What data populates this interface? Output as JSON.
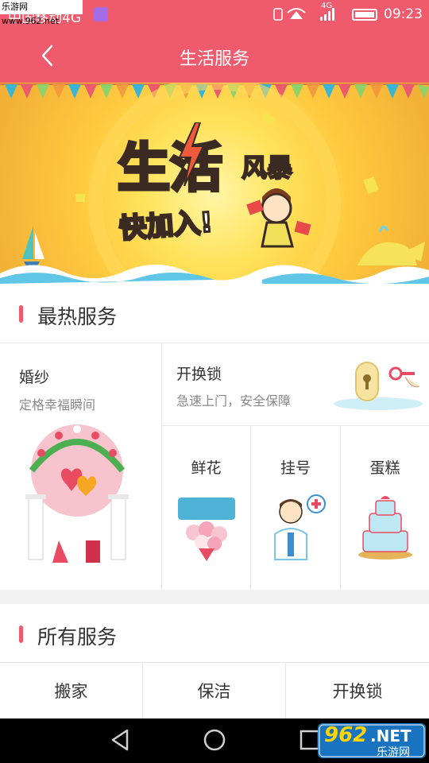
{
  "status_bar": {
    "carrier": "中国移动4G",
    "watermark_text": "乐游网 www.962.net",
    "network_label": "4G",
    "time": "09:23"
  },
  "nav": {
    "title": "生活服务",
    "back_icon": "chevron-left-icon"
  },
  "banner": {
    "headline_part1": "生活",
    "headline_part2": "风暴",
    "tagline": "快加入!"
  },
  "hot_services": {
    "heading": "最热服务",
    "featured": {
      "title": "婚纱",
      "subtitle": "定格幸福瞬间"
    },
    "top_right": {
      "title": "开换锁",
      "subtitle": "急速上门，安全保障"
    },
    "small": [
      {
        "title": "鲜花",
        "icon": "bouquet-icon"
      },
      {
        "title": "挂号",
        "icon": "doctor-icon"
      },
      {
        "title": "蛋糕",
        "icon": "cake-icon"
      }
    ]
  },
  "all_services": {
    "heading": "所有服务",
    "items": [
      "搬家",
      "保洁",
      "开换锁"
    ]
  },
  "system_nav": {
    "back": "triangle-back-icon",
    "home": "circle-home-icon",
    "recent": "square-recent-icon"
  },
  "watermark": {
    "number": "962",
    "suffix": ".NET",
    "caption": "乐游网"
  },
  "colors": {
    "accent": "#ef5b6c",
    "divider": "#e7e7e7",
    "text_primary": "#333333",
    "text_secondary": "#888888"
  }
}
